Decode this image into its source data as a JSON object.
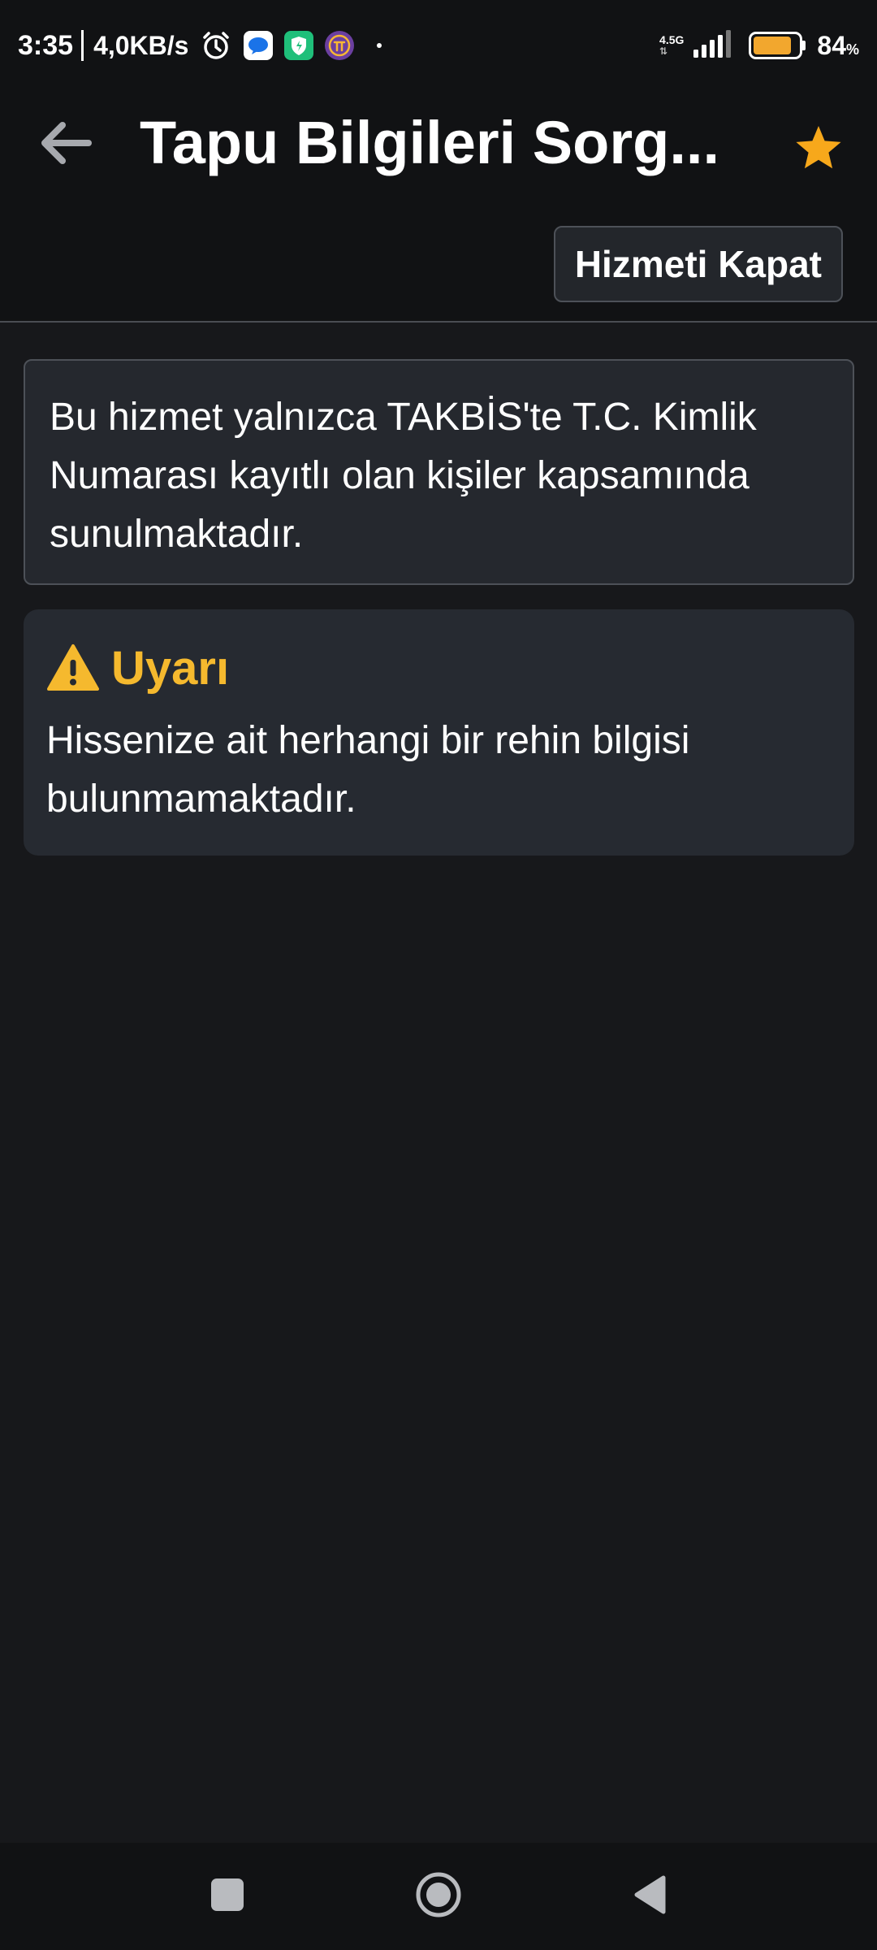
{
  "status_bar": {
    "time": "3:35",
    "net_speed": "4,0KB/s",
    "network_type": "4.5G",
    "battery_percent": "84",
    "battery_unit": "%",
    "battery_level": 0.84,
    "icons": [
      "alarm-icon",
      "messages-app-icon",
      "security-shield-app-icon",
      "pi-network-app-icon",
      "signal-icon",
      "battery-icon"
    ]
  },
  "app_bar": {
    "title": "Tapu Bilgileri Sorg...",
    "back_icon": "arrow-left-icon",
    "favorite_icon": "star-icon"
  },
  "actions": {
    "close_service_label": "Hizmeti Kapat"
  },
  "info": {
    "text": "Bu hizmet yalnızca TAKBİS'te T.C. Kimlik Numarası kayıtlı olan kişiler kapsamında sunulmaktadır."
  },
  "warning": {
    "title": "Uyarı",
    "text": "Hissenize ait herhangi bir rehin bilgisi bulunmamaktadır.",
    "icon": "warning-triangle-icon"
  },
  "nav_bar": {
    "icons": [
      "recent-apps-square-icon",
      "home-circle-icon",
      "back-triangle-icon"
    ]
  },
  "colors": {
    "background": "#17181b",
    "bar_background": "#111214",
    "card_background": "#25282e",
    "accent_amber": "#f5b92e",
    "star_color": "#f7a81b",
    "battery_fill": "#f2a72e"
  }
}
